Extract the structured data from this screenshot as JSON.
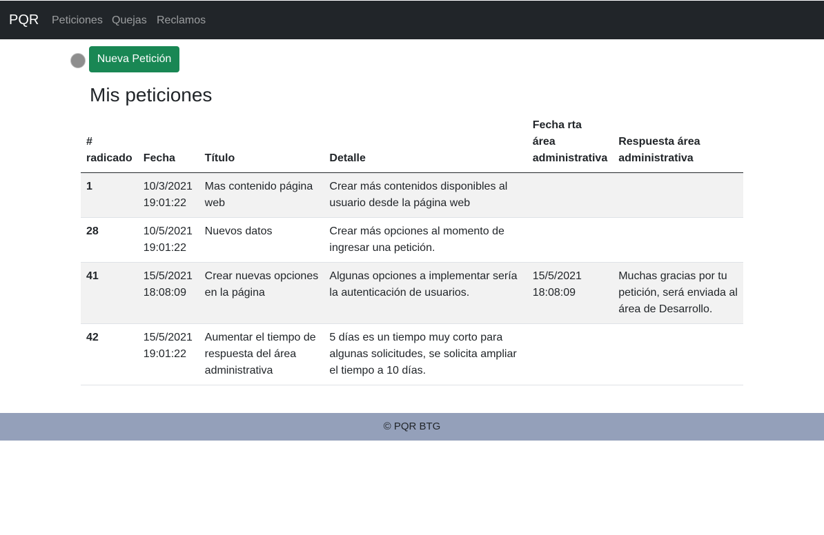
{
  "navbar": {
    "brand": "PQR",
    "links": [
      "Peticiones",
      "Quejas",
      "Reclamos"
    ]
  },
  "actions": {
    "new_button": "Nueva Petición"
  },
  "page": {
    "title": "Mis peticiones"
  },
  "table": {
    "headers": {
      "id_line1": "#",
      "id_line2": "radicado",
      "date": "Fecha",
      "title": "Título",
      "detail": "Detalle",
      "resp_date_line1": "Fecha rta área",
      "resp_date_line2": "administrativa",
      "response_line1": "Respuesta área",
      "response_line2": "administrativa"
    },
    "rows": [
      {
        "id": "1",
        "date": "10/3/2021",
        "time": "19:01:22",
        "title": "Mas contenido página web",
        "detail": "Crear más contenidos disponibles al usuario desde la página web",
        "resp_date": "",
        "resp_time": "",
        "response": ""
      },
      {
        "id": "28",
        "date": "10/5/2021",
        "time": "19:01:22",
        "title": "Nuevos datos",
        "detail": "Crear más opciones al momento de ingresar una petición.",
        "resp_date": "",
        "resp_time": "",
        "response": ""
      },
      {
        "id": "41",
        "date": "15/5/2021",
        "time": "18:08:09",
        "title": "Crear nuevas opciones en la página",
        "detail": "Algunas opciones a implementar sería la autenticación de usuarios.",
        "resp_date": "15/5/2021",
        "resp_time": "18:08:09",
        "response": "Muchas gracias por tu petición, será enviada al área de Desarrollo."
      },
      {
        "id": "42",
        "date": "15/5/2021",
        "time": "19:01:22",
        "title": "Aumentar el tiempo de respuesta del área administrativa",
        "detail": "5 días es un tiempo muy corto para algunas solicitudes, se solicita ampliar el tiempo a 10 días.",
        "resp_date": "",
        "resp_time": "",
        "response": ""
      }
    ]
  },
  "footer": {
    "text": "© PQR BTG"
  },
  "colors": {
    "navbar_bg": "#212529",
    "button_green": "#198754",
    "footer_bg": "#94a0ba",
    "stripe": "#f2f2f2"
  }
}
